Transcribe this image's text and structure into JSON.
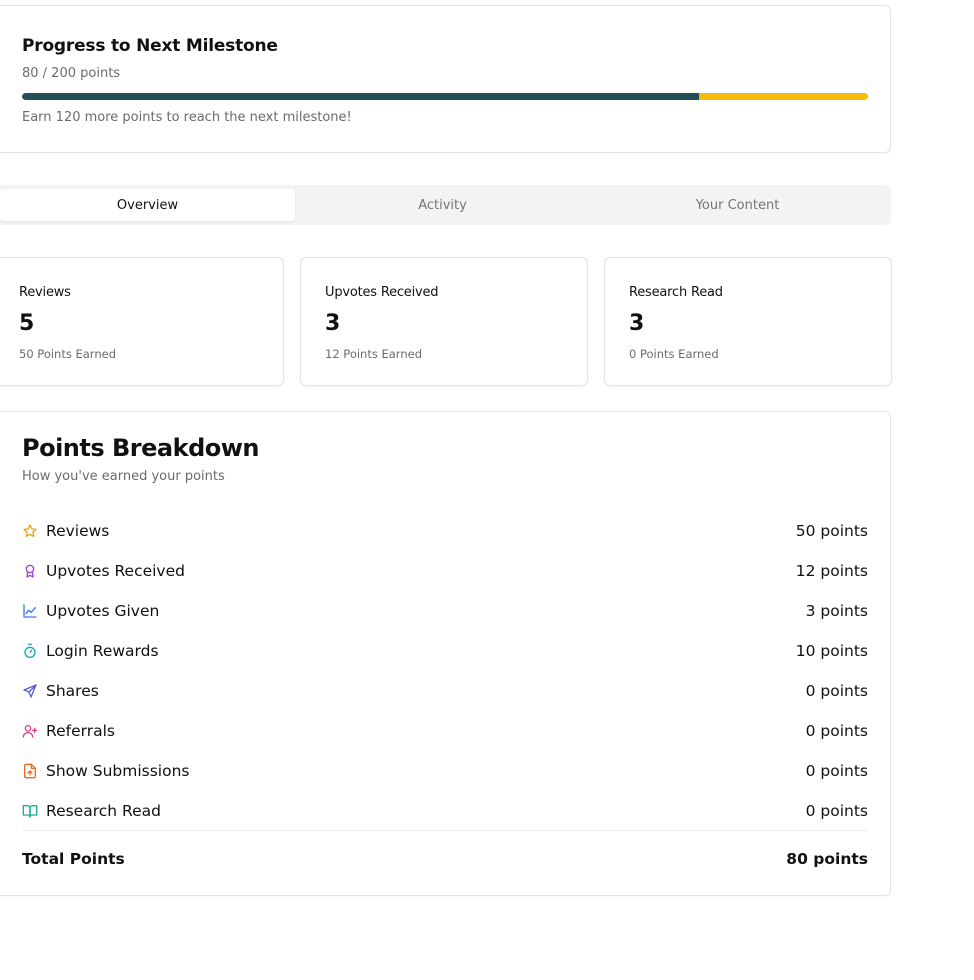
{
  "milestone": {
    "title": "Progress to Next Milestone",
    "progress_text": "80 / 200 points",
    "progress_fraction": 0.8,
    "hint": "Earn 120 more points to reach the next milestone!",
    "colors": {
      "fill": "#234f57",
      "track": "#f5bd07"
    }
  },
  "tabs": [
    {
      "label": "Overview",
      "active": true
    },
    {
      "label": "Activity",
      "active": false
    },
    {
      "label": "Your Content",
      "active": false
    }
  ],
  "stats": [
    {
      "label": "Reviews",
      "value": "5",
      "earned": "50 Points Earned"
    },
    {
      "label": "Upvotes Received",
      "value": "3",
      "earned": "12 Points Earned"
    },
    {
      "label": "Research Read",
      "value": "3",
      "earned": "0 Points Earned"
    }
  ],
  "breakdown": {
    "title": "Points Breakdown",
    "subtitle": "How you've earned your points",
    "items": [
      {
        "label": "Reviews",
        "points": "50 points",
        "icon": "star-icon",
        "color": "#e6a817"
      },
      {
        "label": "Upvotes Received",
        "points": "12 points",
        "icon": "award-icon",
        "color": "#a142d8"
      },
      {
        "label": "Upvotes Given",
        "points": "3 points",
        "icon": "trending-up-icon",
        "color": "#3a78e8"
      },
      {
        "label": "Login Rewards",
        "points": "10 points",
        "icon": "timer-icon",
        "color": "#1ba4bd"
      },
      {
        "label": "Shares",
        "points": "0 points",
        "icon": "send-icon",
        "color": "#5b5bd6"
      },
      {
        "label": "Referrals",
        "points": "0 points",
        "icon": "user-plus-icon",
        "color": "#e0408f"
      },
      {
        "label": "Show Submissions",
        "points": "0 points",
        "icon": "file-upload-icon",
        "color": "#ea6a1f"
      },
      {
        "label": "Research Read",
        "points": "0 points",
        "icon": "book-open-icon",
        "color": "#1aa99a"
      }
    ],
    "total_label": "Total Points",
    "total_value": "80 points"
  }
}
